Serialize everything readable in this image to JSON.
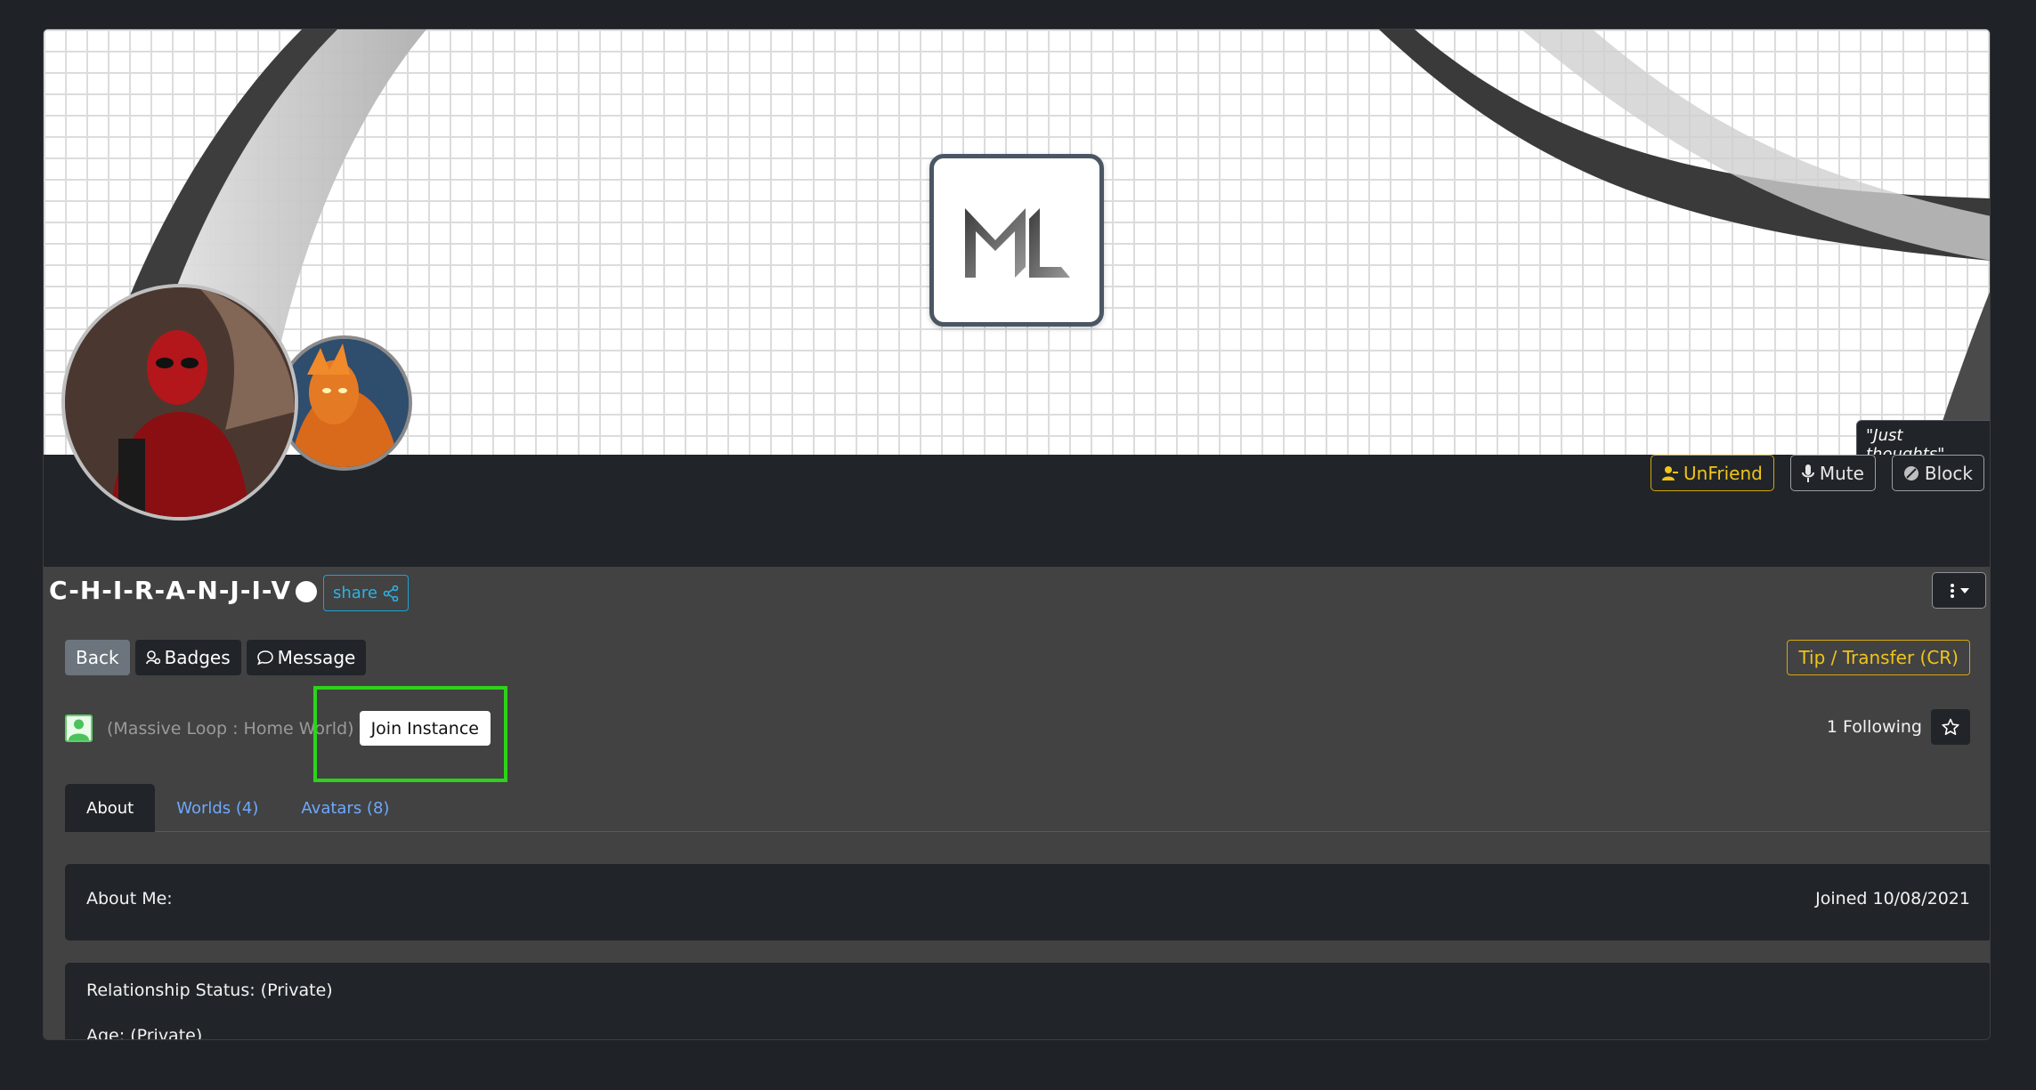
{
  "banner": {
    "logo_text": "ML",
    "quote": "\"Just thoughts\""
  },
  "actions": {
    "unfriend": "UnFriend",
    "mute": "Mute",
    "block": "Block"
  },
  "profile": {
    "name": "C-H-I-R-A-N-J-I-V",
    "share_label": "share"
  },
  "nav": {
    "back": "Back",
    "badges": "Badges",
    "message": "Message",
    "tip": "Tip / Transfer (CR)"
  },
  "instance": {
    "location": "(Massive Loop : Home World)",
    "join_label": "Join Instance"
  },
  "following": {
    "label": "1 Following"
  },
  "tabs": [
    {
      "label": "About"
    },
    {
      "label": "Worlds (4)"
    },
    {
      "label": "Avatars (8)"
    }
  ],
  "about": {
    "label": "About Me:",
    "joined": "Joined 10/08/2021"
  },
  "details": {
    "relationship": "Relationship Status: (Private)",
    "age": "Age: (Private)"
  },
  "colors": {
    "page_bg": "#1f2226",
    "card_bg": "#212529",
    "panel_bg": "#424242",
    "warn": "#f0c419",
    "link": "#6ea8fe",
    "share": "#28b4e6",
    "highlight": "#2dd31a"
  }
}
